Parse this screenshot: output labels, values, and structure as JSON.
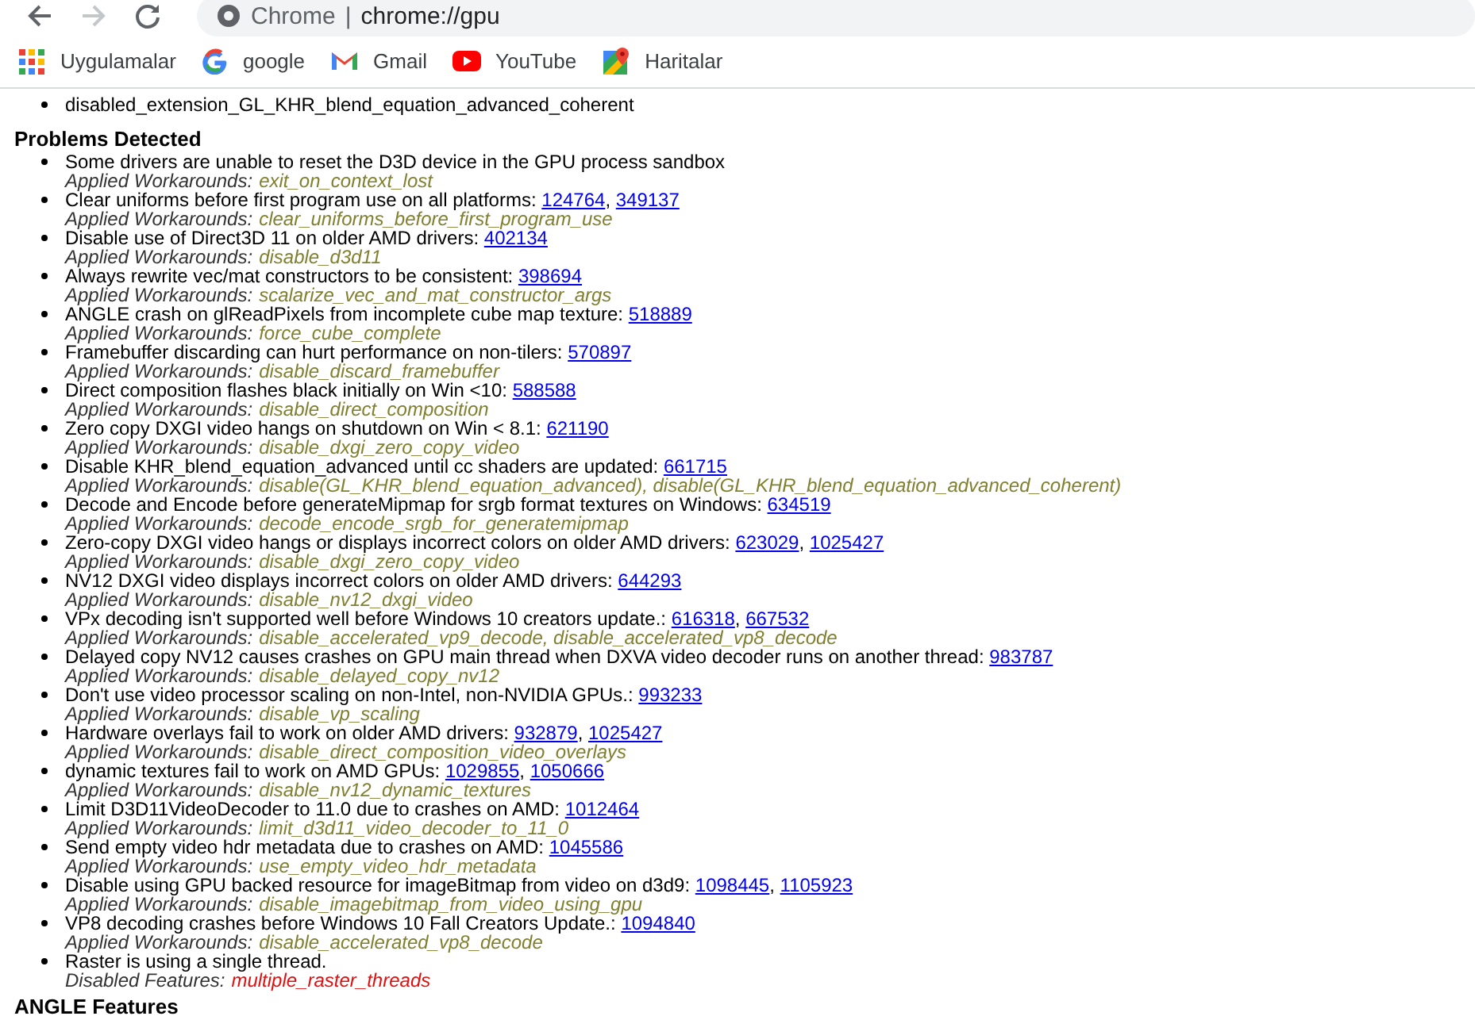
{
  "browser": {
    "back_enabled": true,
    "forward_enabled": false,
    "omnibox": {
      "site_label": "Chrome",
      "separator": "|",
      "url": "chrome://gpu"
    }
  },
  "bookmarks": [
    {
      "kind": "apps",
      "label": "Uygulamalar"
    },
    {
      "kind": "google",
      "label": "google"
    },
    {
      "kind": "gmail",
      "label": "Gmail"
    },
    {
      "kind": "youtube",
      "label": "YouTube"
    },
    {
      "kind": "maps",
      "label": "Haritalar"
    }
  ],
  "disabled_extensions": [
    "disabled_extension_GL_KHR_blend_equation_advanced_coherent"
  ],
  "problems_section": {
    "title": "Problems Detected",
    "bug_separator": ", ",
    "problems": [
      {
        "description": "Some drivers are unable to reset the D3D device in the GPU process sandbox",
        "kind": "workaround",
        "label": "Applied Workarounds:",
        "value": "exit_on_context_lost"
      },
      {
        "description": "Clear uniforms before first program use on all platforms:",
        "bugs": [
          "124764",
          "349137"
        ],
        "kind": "workaround",
        "label": "Applied Workarounds:",
        "value": "clear_uniforms_before_first_program_use"
      },
      {
        "description": "Disable use of Direct3D 11 on older AMD drivers:",
        "bugs": [
          "402134"
        ],
        "kind": "workaround",
        "label": "Applied Workarounds:",
        "value": "disable_d3d11"
      },
      {
        "description": "Always rewrite vec/mat constructors to be consistent:",
        "bugs": [
          "398694"
        ],
        "kind": "workaround",
        "label": "Applied Workarounds:",
        "value": "scalarize_vec_and_mat_constructor_args"
      },
      {
        "description": "ANGLE crash on glReadPixels from incomplete cube map texture:",
        "bugs": [
          "518889"
        ],
        "kind": "workaround",
        "label": "Applied Workarounds:",
        "value": "force_cube_complete"
      },
      {
        "description": "Framebuffer discarding can hurt performance on non-tilers:",
        "bugs": [
          "570897"
        ],
        "kind": "workaround",
        "label": "Applied Workarounds:",
        "value": "disable_discard_framebuffer"
      },
      {
        "description": "Direct composition flashes black initially on Win <10:",
        "bugs": [
          "588588"
        ],
        "kind": "workaround",
        "label": "Applied Workarounds:",
        "value": "disable_direct_composition"
      },
      {
        "description": "Zero copy DXGI video hangs on shutdown on Win < 8.1:",
        "bugs": [
          "621190"
        ],
        "kind": "workaround",
        "label": "Applied Workarounds:",
        "value": "disable_dxgi_zero_copy_video"
      },
      {
        "description": "Disable KHR_blend_equation_advanced until cc shaders are updated:",
        "bugs": [
          "661715"
        ],
        "kind": "workaround",
        "label": "Applied Workarounds:",
        "value": "disable(GL_KHR_blend_equation_advanced), disable(GL_KHR_blend_equation_advanced_coherent)"
      },
      {
        "description": "Decode and Encode before generateMipmap for srgb format textures on Windows:",
        "bugs": [
          "634519"
        ],
        "kind": "workaround",
        "label": "Applied Workarounds:",
        "value": "decode_encode_srgb_for_generatemipmap"
      },
      {
        "description": "Zero-copy DXGI video hangs or displays incorrect colors on older AMD drivers:",
        "bugs": [
          "623029",
          "1025427"
        ],
        "kind": "workaround",
        "label": "Applied Workarounds:",
        "value": "disable_dxgi_zero_copy_video"
      },
      {
        "description": "NV12 DXGI video displays incorrect colors on older AMD drivers:",
        "bugs": [
          "644293"
        ],
        "kind": "workaround",
        "label": "Applied Workarounds:",
        "value": "disable_nv12_dxgi_video"
      },
      {
        "description": "VPx decoding isn't supported well before Windows 10 creators update.:",
        "bugs": [
          "616318",
          "667532"
        ],
        "kind": "workaround",
        "label": "Applied Workarounds:",
        "value": "disable_accelerated_vp9_decode, disable_accelerated_vp8_decode"
      },
      {
        "description": "Delayed copy NV12 causes crashes on GPU main thread when DXVA video decoder runs on another thread:",
        "bugs": [
          "983787"
        ],
        "kind": "workaround",
        "label": "Applied Workarounds:",
        "value": "disable_delayed_copy_nv12"
      },
      {
        "description": "Don't use video processor scaling on non-Intel, non-NVIDIA GPUs.:",
        "bugs": [
          "993233"
        ],
        "kind": "workaround",
        "label": "Applied Workarounds:",
        "value": "disable_vp_scaling"
      },
      {
        "description": "Hardware overlays fail to work on older AMD drivers:",
        "bugs": [
          "932879",
          "1025427"
        ],
        "kind": "workaround",
        "label": "Applied Workarounds:",
        "value": "disable_direct_composition_video_overlays"
      },
      {
        "description": "dynamic textures fail to work on AMD GPUs:",
        "bugs": [
          "1029855",
          "1050666"
        ],
        "kind": "workaround",
        "label": "Applied Workarounds:",
        "value": "disable_nv12_dynamic_textures"
      },
      {
        "description": "Limit D3D11VideoDecoder to 11.0 due to crashes on AMD:",
        "bugs": [
          "1012464"
        ],
        "kind": "workaround",
        "label": "Applied Workarounds:",
        "value": "limit_d3d11_video_decoder_to_11_0"
      },
      {
        "description": "Send empty video hdr metadata due to crashes on AMD:",
        "bugs": [
          "1045586"
        ],
        "kind": "workaround",
        "label": "Applied Workarounds:",
        "value": "use_empty_video_hdr_metadata"
      },
      {
        "description": "Disable using GPU backed resource for imageBitmap from video on d3d9:",
        "bugs": [
          "1098445",
          "1105923"
        ],
        "kind": "workaround",
        "label": "Applied Workarounds:",
        "value": "disable_imagebitmap_from_video_using_gpu"
      },
      {
        "description": "VP8 decoding crashes before Windows 10 Fall Creators Update.:",
        "bugs": [
          "1094840"
        ],
        "kind": "workaround",
        "label": "Applied Workarounds:",
        "value": "disable_accelerated_vp8_decode"
      },
      {
        "description": "Raster is using a single thread.",
        "kind": "disabled",
        "label": "Disabled Features:",
        "value": "multiple_raster_threads"
      }
    ]
  },
  "next_section": {
    "title": "ANGLE Features"
  }
}
